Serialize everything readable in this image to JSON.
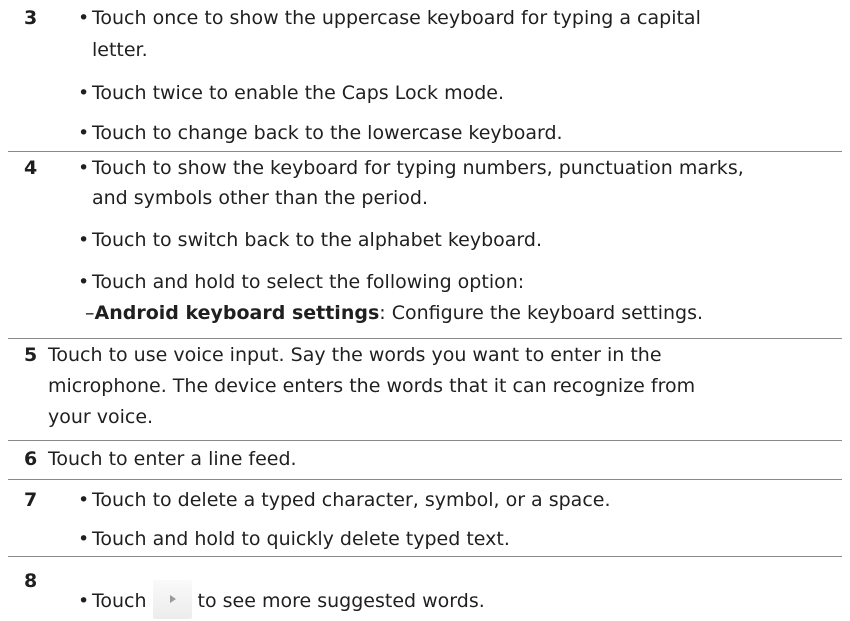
{
  "rows": [
    {
      "number": "3",
      "lines": [
        "Touch once to show the uppercase keyboard for typing a capital",
        "letter.",
        "Touch twice to enable the Caps Lock mode.",
        "Touch to change back to the lowercase keyboard."
      ]
    },
    {
      "number": "4",
      "lines": [
        "Touch to show the keyboard for typing numbers, punctuation marks,",
        "and symbols other than the period.",
        "Touch to switch back to the alphabet keyboard.",
        "Touch and hold to select the following option:"
      ],
      "option_label": "Android keyboard settings",
      "option_text": ": Configure the keyboard settings."
    },
    {
      "number": "5",
      "lines": [
        "Touch to use voice input. Say the words you want to enter in the",
        "microphone. The device enters the words that it can recognize from",
        "your voice."
      ]
    },
    {
      "number": "6",
      "lines": [
        "Touch to enter a line feed."
      ]
    },
    {
      "number": "7",
      "lines": [
        "Touch to delete a typed character, symbol, or a space.",
        "Touch and hold to quickly delete typed text."
      ]
    },
    {
      "number": "8",
      "before_icon": "Touch",
      "after_icon": "to see more suggested words.",
      "icon": "play-arrow-icon"
    }
  ],
  "bullet": "•",
  "dash": "–"
}
